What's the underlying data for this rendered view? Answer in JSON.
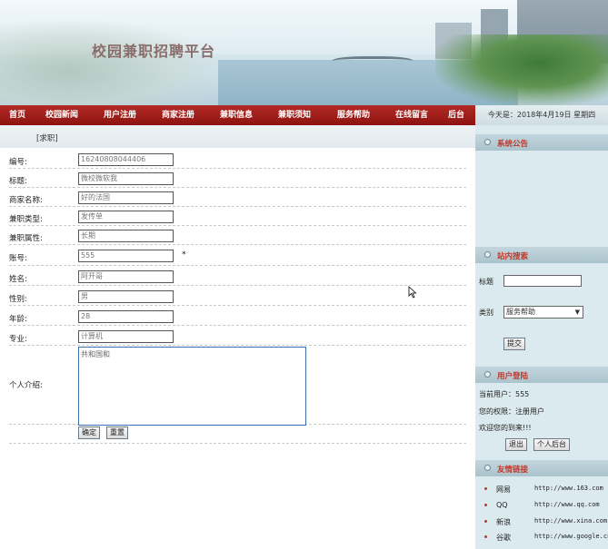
{
  "site_title": "校园兼职招聘平台",
  "nav": [
    "首页",
    "校园新闻",
    "用户注册",
    "商家注册",
    "兼职信息",
    "兼职须知",
    "服务帮助",
    "在线留言",
    "后台"
  ],
  "date_text": "今天是：2018年4月19日 星期四",
  "breadcrumb": "[求职]",
  "form": {
    "fields": [
      {
        "label": "编号:",
        "value": "16240808044406"
      },
      {
        "label": "标题:",
        "value": "微校微软我"
      },
      {
        "label": "商家名称:",
        "value": "好的法国"
      },
      {
        "label": "兼职类型:",
        "value": "发传单"
      },
      {
        "label": "兼职属性:",
        "value": "长期"
      },
      {
        "label": "账号:",
        "value": "555"
      },
      {
        "label": "姓名:",
        "value": "阿开哥"
      },
      {
        "label": "性别:",
        "value": "男"
      },
      {
        "label": "年龄:",
        "value": "28"
      },
      {
        "label": "专业:",
        "value": "计算机"
      }
    ],
    "required_mark": "*",
    "intro_label": "个人介绍:",
    "intro_value": "共和国和",
    "submit_label": "确定",
    "reset_label": "重置"
  },
  "sidebar": {
    "notice_title": "系统公告",
    "search": {
      "title": "站内搜索",
      "title_label": "标题",
      "category_label": "类别",
      "category_value": "服务帮助",
      "submit_label": "提交"
    },
    "login": {
      "title": "用户登陆",
      "current_user": "当前用户：555",
      "role": "您的权限：注册用户",
      "welcome": "欢迎您的到来!!!",
      "logout_label": "退出",
      "profile_label": "个人后台"
    },
    "links": {
      "title": "友情链接",
      "items": [
        {
          "name": "网易",
          "url": "http://www.163.com"
        },
        {
          "name": "QQ",
          "url": "http://www.qq.com"
        },
        {
          "name": "新浪",
          "url": "http://www.xina.com"
        },
        {
          "name": "谷歌",
          "url": "http://www.google.cn"
        }
      ]
    }
  },
  "colors": {
    "nav_bg": "#9a1c17",
    "sidebar_bg": "#dbeaee",
    "accent_text": "#c0382b"
  }
}
